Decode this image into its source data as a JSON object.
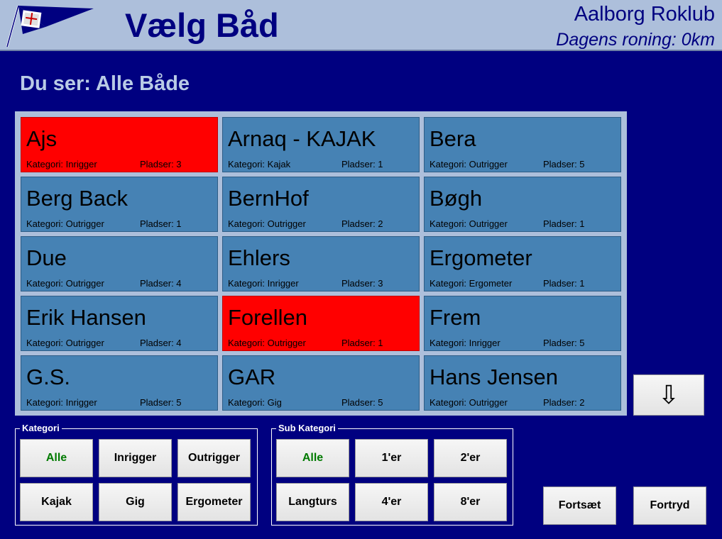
{
  "header": {
    "title": "Vælg Båd",
    "club": "Aalborg Roklub",
    "daily_rowing": "Dagens roning: 0km",
    "logo": "club-burgee-icon"
  },
  "viewing": "Du ser: Alle Både",
  "boats": [
    {
      "name": "Ajs",
      "category": "Kategori: Inrigger",
      "seats": "Pladser: 3",
      "status": "red"
    },
    {
      "name": "Arnaq - KAJAK",
      "category": "Kategori: Kajak",
      "seats": "Pladser: 1",
      "status": "blue"
    },
    {
      "name": "Bera",
      "category": "Kategori: Outrigger",
      "seats": "Pladser: 5",
      "status": "blue"
    },
    {
      "name": "Berg Back",
      "category": "Kategori: Outrigger",
      "seats": "Pladser: 1",
      "status": "blue"
    },
    {
      "name": "BernHof",
      "category": "Kategori: Outrigger",
      "seats": "Pladser: 2",
      "status": "blue"
    },
    {
      "name": "Bøgh",
      "category": "Kategori: Outrigger",
      "seats": "Pladser: 1",
      "status": "blue"
    },
    {
      "name": "Due",
      "category": "Kategori: Outrigger",
      "seats": "Pladser: 4",
      "status": "blue"
    },
    {
      "name": "Ehlers",
      "category": "Kategori: Inrigger",
      "seats": "Pladser: 3",
      "status": "blue"
    },
    {
      "name": "Ergometer",
      "category": "Kategori: Ergometer",
      "seats": "Pladser: 1",
      "status": "blue"
    },
    {
      "name": "Erik Hansen",
      "category": "Kategori: Outrigger",
      "seats": "Pladser: 4",
      "status": "blue"
    },
    {
      "name": "Forellen",
      "category": "Kategori: Outrigger",
      "seats": "Pladser: 1",
      "status": "red"
    },
    {
      "name": "Frem",
      "category": "Kategori: Inrigger",
      "seats": "Pladser: 5",
      "status": "blue"
    },
    {
      "name": "G.S.",
      "category": "Kategori: Inrigger",
      "seats": "Pladser: 5",
      "status": "blue"
    },
    {
      "name": "GAR",
      "category": "Kategori: Gig",
      "seats": "Pladser: 5",
      "status": "blue"
    },
    {
      "name": "Hans Jensen",
      "category": "Kategori: Outrigger",
      "seats": "Pladser: 2",
      "status": "blue"
    }
  ],
  "scroll_down": "⇩",
  "kategori": {
    "legend": "Kategori",
    "buttons": [
      "Alle",
      "Inrigger",
      "Outrigger",
      "Kajak",
      "Gig",
      "Ergometer"
    ],
    "selected": "Alle"
  },
  "sub_kategori": {
    "legend": "Sub Kategori",
    "buttons": [
      "Alle",
      "1'er",
      "2'er",
      "Langturs",
      "4'er",
      "8'er"
    ],
    "selected": "Alle"
  },
  "actions": {
    "continue": "Fortsæt",
    "cancel": "Fortryd"
  },
  "colors": {
    "background": "#000080",
    "header": "#adbfdb",
    "boat_available": "#4682b4",
    "boat_in_use": "#ff0000",
    "selected_filter": "#007a00"
  }
}
